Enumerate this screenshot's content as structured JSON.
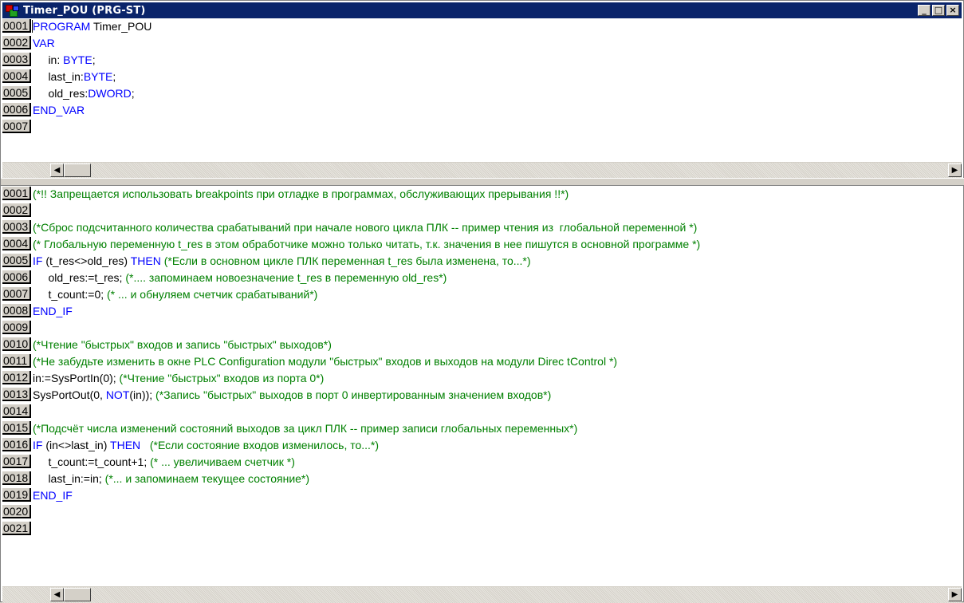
{
  "window": {
    "title": "Timer_POU (PRG-ST)",
    "buttons": {
      "minimize": "_",
      "maximize": "□",
      "close": "×"
    }
  },
  "declaration_pane": {
    "lines": [
      {
        "num": "0001",
        "parts": [
          {
            "t": "kw",
            "s": "PROGRAM"
          },
          {
            "t": "tx",
            "s": " Timer_POU"
          }
        ]
      },
      {
        "num": "0002",
        "parts": [
          {
            "t": "kw",
            "s": "VAR"
          }
        ]
      },
      {
        "num": "0003",
        "parts": [
          {
            "t": "tx",
            "s": "     in: "
          },
          {
            "t": "kw",
            "s": "BYTE"
          },
          {
            "t": "tx",
            "s": ";"
          }
        ]
      },
      {
        "num": "0004",
        "parts": [
          {
            "t": "tx",
            "s": "     last_in:"
          },
          {
            "t": "kw",
            "s": "BYTE"
          },
          {
            "t": "tx",
            "s": ";"
          }
        ]
      },
      {
        "num": "0005",
        "parts": [
          {
            "t": "tx",
            "s": "     old_res:"
          },
          {
            "t": "kw",
            "s": "DWORD"
          },
          {
            "t": "tx",
            "s": ";"
          }
        ]
      },
      {
        "num": "0006",
        "parts": [
          {
            "t": "kw",
            "s": "END_VAR"
          }
        ]
      },
      {
        "num": "0007",
        "parts": []
      }
    ]
  },
  "body_pane": {
    "lines": [
      {
        "num": "0001",
        "parts": [
          {
            "t": "cm",
            "s": "(*!! Запрещается использовать breakpoints при отладке в программах, обслуживающих прерывания !!*)"
          }
        ]
      },
      {
        "num": "0002",
        "parts": []
      },
      {
        "num": "0003",
        "parts": [
          {
            "t": "cm",
            "s": "(*Сброс подсчитанного количества срабатываний при начале нового цикла ПЛК -- пример чтения из  глобальной переменной *)"
          }
        ]
      },
      {
        "num": "0004",
        "parts": [
          {
            "t": "cm",
            "s": "(* Глобальную переменную t_res в этом обработчике можно только читать, т.к. значения в нее пишутся в основной программе *)"
          }
        ]
      },
      {
        "num": "0005",
        "parts": [
          {
            "t": "kw",
            "s": "IF"
          },
          {
            "t": "tx",
            "s": " (t_res<>old_res) "
          },
          {
            "t": "kw",
            "s": "THEN"
          },
          {
            "t": "tx",
            "s": " "
          },
          {
            "t": "cm",
            "s": "(*Если в основном цикле ПЛК переменная t_res была изменена, то...*)"
          }
        ]
      },
      {
        "num": "0006",
        "parts": [
          {
            "t": "tx",
            "s": "     old_res:=t_res; "
          },
          {
            "t": "cm",
            "s": "(*.... запоминаем новоезначение t_res в переменную old_res*)"
          }
        ]
      },
      {
        "num": "0007",
        "parts": [
          {
            "t": "tx",
            "s": "     t_count:=0; "
          },
          {
            "t": "cm",
            "s": "(* ... и обнуляем счетчик срабатываний*)"
          }
        ]
      },
      {
        "num": "0008",
        "parts": [
          {
            "t": "kw",
            "s": "END_IF"
          }
        ]
      },
      {
        "num": "0009",
        "parts": []
      },
      {
        "num": "0010",
        "parts": [
          {
            "t": "cm",
            "s": "(*Чтение \"быстрых\" входов и запись \"быстрых\" выходов*)"
          }
        ]
      },
      {
        "num": "0011",
        "parts": [
          {
            "t": "cm",
            "s": "(*Не забудьте изменить в окне PLC Configuration модули \"быстрых\" входов и выходов на модули Direc tControl *)"
          }
        ]
      },
      {
        "num": "0012",
        "parts": [
          {
            "t": "tx",
            "s": "in:=SysPortIn(0); "
          },
          {
            "t": "cm",
            "s": "(*Чтение \"быстрых\" входов из порта 0*)"
          }
        ]
      },
      {
        "num": "0013",
        "parts": [
          {
            "t": "tx",
            "s": "SysPortOut(0, "
          },
          {
            "t": "kw",
            "s": "NOT"
          },
          {
            "t": "tx",
            "s": "(in)); "
          },
          {
            "t": "cm",
            "s": "(*Запись \"быстрых\" выходов в порт 0 инвертированным значением входов*)"
          }
        ]
      },
      {
        "num": "0014",
        "parts": []
      },
      {
        "num": "0015",
        "parts": [
          {
            "t": "cm",
            "s": "(*Подсчёт числа изменений состояний выходов за цикл ПЛК -- пример записи глобальных переменных*)"
          }
        ]
      },
      {
        "num": "0016",
        "parts": [
          {
            "t": "kw",
            "s": "IF"
          },
          {
            "t": "tx",
            "s": " (in<>last_in) "
          },
          {
            "t": "kw",
            "s": "THEN"
          },
          {
            "t": "tx",
            "s": "   "
          },
          {
            "t": "cm",
            "s": "(*Если состояние входов изменилось, то...*)"
          }
        ]
      },
      {
        "num": "0017",
        "parts": [
          {
            "t": "tx",
            "s": "     t_count:=t_count+1; "
          },
          {
            "t": "cm",
            "s": "(* ... увеличиваем счетчик *)"
          }
        ]
      },
      {
        "num": "0018",
        "parts": [
          {
            "t": "tx",
            "s": "     last_in:=in; "
          },
          {
            "t": "cm",
            "s": "(*... и запоминаем текущее состояние*)"
          }
        ]
      },
      {
        "num": "0019",
        "parts": [
          {
            "t": "kw",
            "s": "END_IF"
          }
        ]
      },
      {
        "num": "0020",
        "parts": []
      },
      {
        "num": "0021",
        "parts": []
      }
    ]
  },
  "scrollbar": {
    "left_arrow": "◀",
    "right_arrow": "▶"
  },
  "colors": {
    "keyword": "#0000ff",
    "comment": "#008000",
    "text": "#000000",
    "titlebar": "#0a246a"
  }
}
